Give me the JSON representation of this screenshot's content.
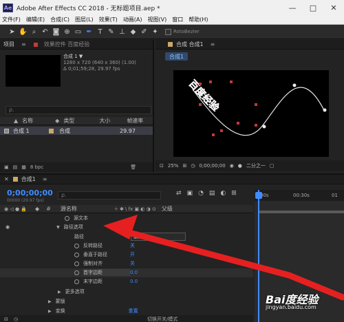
{
  "window": {
    "title": "Adobe After Effects CC 2018 - 无标题项目.aep *",
    "logo": "Ae",
    "min": "—",
    "max": "□",
    "close": "✕"
  },
  "menu": [
    "文件(F)",
    "编辑(E)",
    "合成(C)",
    "图层(L)",
    "效果(T)",
    "动画(A)",
    "视图(V)",
    "窗口",
    "帮助(H)"
  ],
  "toolbar": {
    "rotobezier_label": "RotoBezier",
    "icons": [
      "selection-icon",
      "hand-icon",
      "zoom-icon",
      "rotate-icon",
      "camera-orbit-icon",
      "pan-behind-icon",
      "rectangle-icon",
      "pen-icon",
      "type-icon",
      "brush-icon",
      "clone-stamp-icon",
      "eraser-icon",
      "roto-brush-icon",
      "puppet-icon"
    ]
  },
  "project": {
    "tab_label": "项目",
    "menu_icon": "≡",
    "effects_tab_label": "效果控件 百度经验",
    "item_name": "合成 1 ▼",
    "item_size": "1280 x 720 (640 x 360) (1.00)",
    "item_duration": "Δ 0;01;59;28, 29.97 fps",
    "search_placeholder": "ρ.",
    "columns": {
      "name": "名称",
      "type": "类型",
      "size": "大小",
      "fps": "帧速率"
    },
    "row": {
      "name": "合成 1",
      "type": "合成",
      "fps": "29.97"
    },
    "footer_bpc": "8 bpc"
  },
  "comp": {
    "panel_label": "合成 合成1",
    "menu_icon": "≡",
    "subtab_label": "合成1",
    "zoom": "25%",
    "timecode": "0;00;00;00",
    "resolution": "二分之一",
    "colors": {
      "accent": "#3f8cff",
      "text_red": "#d43030",
      "point": "#c03a3a"
    }
  },
  "comp_text": "百度经验",
  "timeline": {
    "tab_label": "合成1",
    "menu_icon": "≡",
    "timecode": "0;00;00;00",
    "timecode_sub": "00000 (29.97 fps)",
    "search_placeholder": "ρ.",
    "header": {
      "name": "源名称",
      "parent": "父级"
    },
    "ruler": [
      "00s",
      "00:30s",
      "01"
    ],
    "rows": [
      {
        "label": "源文本",
        "value": ""
      },
      {
        "label": "路径选项",
        "value": ""
      },
      {
        "label": "路径",
        "value": "蒙版 1"
      },
      {
        "label": "反转路径",
        "value": "关"
      },
      {
        "label": "垂直于路径",
        "value": "开"
      },
      {
        "label": "强制对齐",
        "value": "关"
      },
      {
        "label": "首字边距",
        "value": "0.0"
      },
      {
        "label": "末字边距",
        "value": "0.0"
      },
      {
        "label": "更多选项",
        "value": ""
      },
      {
        "label": "蒙版",
        "value": ""
      },
      {
        "label": "变换",
        "value": "重置"
      }
    ],
    "footer_label": "切换开关/模式"
  },
  "watermark": {
    "brand": "Bai度经验",
    "url": "jingyan.baidu.com"
  }
}
